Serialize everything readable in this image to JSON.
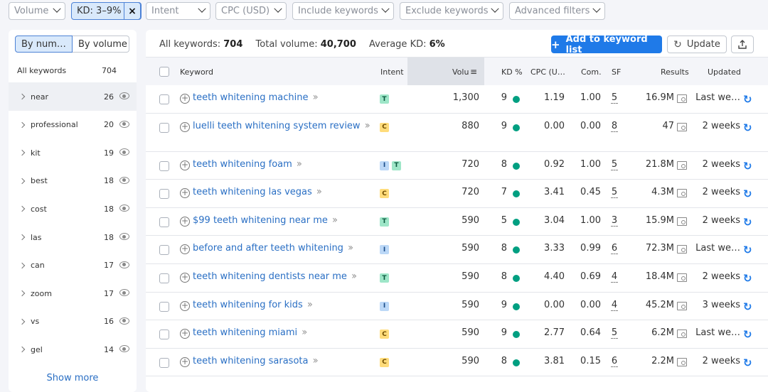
{
  "filters": [
    {
      "label": "Volume",
      "active": false
    },
    {
      "label": "KD: 3–9%",
      "active": true,
      "clear_icon": "close-icon"
    },
    {
      "label": "Intent",
      "active": false
    },
    {
      "label": "CPC (USD)",
      "active": false
    },
    {
      "label": "Include keywords",
      "active": false
    },
    {
      "label": "Exclude keywords",
      "active": false
    },
    {
      "label": "Advanced filters",
      "active": false
    }
  ],
  "sidebar": {
    "toggle": {
      "by_number": "By num…",
      "by_volume": "By volume"
    },
    "all_label": "All keywords",
    "all_count": "704",
    "groups": [
      {
        "name": "near",
        "count": "26"
      },
      {
        "name": "professional",
        "count": "20"
      },
      {
        "name": "kit",
        "count": "19"
      },
      {
        "name": "best",
        "count": "18"
      },
      {
        "name": "cost",
        "count": "18"
      },
      {
        "name": "las",
        "count": "18"
      },
      {
        "name": "can",
        "count": "17"
      },
      {
        "name": "zoom",
        "count": "17"
      },
      {
        "name": "vs",
        "count": "16"
      },
      {
        "name": "gel",
        "count": "14"
      }
    ],
    "show_more": "Show more"
  },
  "summary": {
    "all_label": "All keywords:",
    "all_value": "704",
    "volume_label": "Total volume:",
    "volume_value": "40,700",
    "kd_label": "Average KD:",
    "kd_value": "6%"
  },
  "toolbar": {
    "add_label": "Add to keyword list",
    "update_label": "Update"
  },
  "columns": {
    "keyword": "Keyword",
    "intent": "Intent",
    "volume": "Volu",
    "kd": "KD %",
    "cpc": "CPC (U…",
    "com": "Com.",
    "sf": "SF",
    "results": "Results",
    "updated": "Updated"
  },
  "rows": [
    {
      "keyword": "teeth whitening machine",
      "intent": [
        "T"
      ],
      "volume": "1,300",
      "kd": "9",
      "cpc": "1.19",
      "com": "1.00",
      "sf": "5",
      "results": "16.9M",
      "updated": "Last we…"
    },
    {
      "keyword": "luelli teeth whitening system review",
      "intent": [
        "C"
      ],
      "volume": "880",
      "kd": "9",
      "cpc": "0.00",
      "com": "0.00",
      "sf": "8",
      "results": "47",
      "updated": "2 weeks"
    },
    {
      "keyword": "teeth whitening foam",
      "intent": [
        "I",
        "T"
      ],
      "volume": "720",
      "kd": "8",
      "cpc": "0.92",
      "com": "1.00",
      "sf": "5",
      "results": "21.8M",
      "updated": "2 weeks"
    },
    {
      "keyword": "teeth whitening las vegas",
      "intent": [
        "C"
      ],
      "volume": "720",
      "kd": "7",
      "cpc": "3.41",
      "com": "0.45",
      "sf": "5",
      "results": "4.3M",
      "updated": "2 weeks"
    },
    {
      "keyword": "$99 teeth whitening near me",
      "intent": [
        "T"
      ],
      "volume": "590",
      "kd": "5",
      "cpc": "3.04",
      "com": "1.00",
      "sf": "3",
      "results": "15.9M",
      "updated": "2 weeks"
    },
    {
      "keyword": "before and after teeth whitening",
      "intent": [
        "I"
      ],
      "volume": "590",
      "kd": "8",
      "cpc": "3.33",
      "com": "0.99",
      "sf": "6",
      "results": "72.3M",
      "updated": "Last we…"
    },
    {
      "keyword": "teeth whitening dentists near me",
      "intent": [
        "T"
      ],
      "volume": "590",
      "kd": "8",
      "cpc": "4.40",
      "com": "0.69",
      "sf": "4",
      "results": "18.4M",
      "updated": "2 weeks"
    },
    {
      "keyword": "teeth whitening for kids",
      "intent": [
        "I"
      ],
      "volume": "590",
      "kd": "9",
      "cpc": "0.00",
      "com": "0.00",
      "sf": "4",
      "results": "45.2M",
      "updated": "3 weeks"
    },
    {
      "keyword": "teeth whitening miami",
      "intent": [
        "C"
      ],
      "volume": "590",
      "kd": "9",
      "cpc": "2.77",
      "com": "0.64",
      "sf": "5",
      "results": "6.2M",
      "updated": "Last we…"
    },
    {
      "keyword": "teeth whitening sarasota",
      "intent": [
        "C"
      ],
      "volume": "590",
      "kd": "8",
      "cpc": "3.81",
      "com": "0.15",
      "sf": "6",
      "results": "2.2M",
      "updated": "2 weeks"
    }
  ],
  "colors": {
    "accent": "#1f7ae8",
    "kd_dot": "#009f81",
    "link": "#2a6fc4"
  }
}
